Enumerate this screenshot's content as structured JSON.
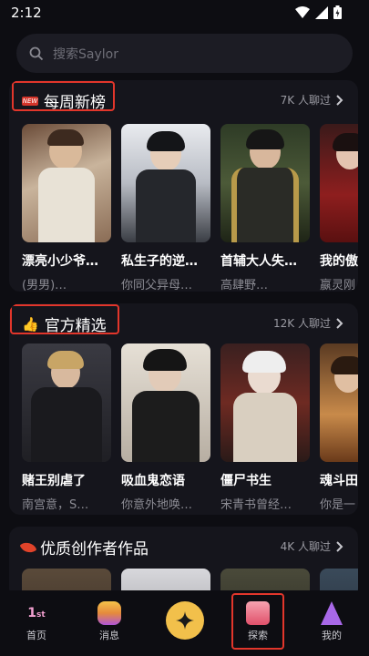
{
  "status": {
    "time": "2:12"
  },
  "search": {
    "placeholder": "搜索Saylor"
  },
  "sections": [
    {
      "title": "每周新榜",
      "count": "7K 人聊过",
      "cards": [
        {
          "title": "漂亮小少爷…",
          "sub": "(男男)…"
        },
        {
          "title": "私生子的逆…",
          "sub": "你同父异母…"
        },
        {
          "title": "首辅大人失…",
          "sub": "高肆野…"
        },
        {
          "title": "我的傲",
          "sub": "嬴灵刚"
        }
      ]
    },
    {
      "title": "官方精选",
      "count": "12K 人聊过",
      "cards": [
        {
          "title": "赌王别虐了",
          "sub": "南宫意，S…"
        },
        {
          "title": "吸血鬼恋语",
          "sub": "你意外地唤…"
        },
        {
          "title": "僵尸书生",
          "sub": "宋青书曾经…"
        },
        {
          "title": "魂斗田",
          "sub": "你是一"
        }
      ]
    },
    {
      "title": "优质创作者作品",
      "count": "4K 人聊过"
    }
  ],
  "nav": {
    "home": "首页",
    "messages": "消息",
    "explore": "探索",
    "mine": "我的"
  },
  "colors": {
    "accent": "#f2c04b",
    "highlight": "#e2362b",
    "bg": "#0d0d12"
  }
}
